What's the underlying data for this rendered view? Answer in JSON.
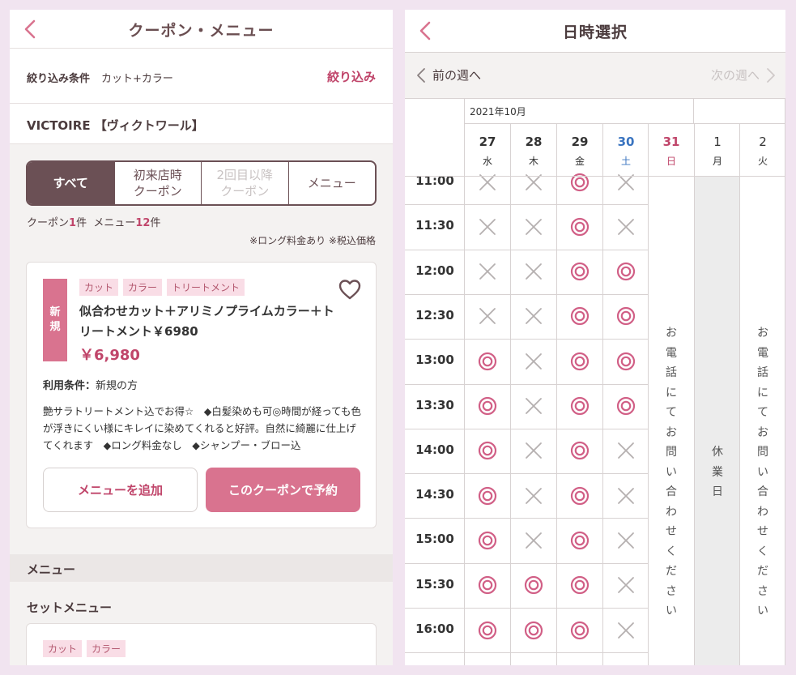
{
  "left": {
    "header": {
      "title": "クーポン・メニュー"
    },
    "filter": {
      "label": "絞り込み条件",
      "value": "カット+カラー",
      "button": "絞り込み"
    },
    "salon": {
      "name": "VICTOIRE 【ヴィクトワール】"
    },
    "tabs": [
      {
        "label": "すべて",
        "state": "active"
      },
      {
        "label": "初来店時\nクーポン",
        "state": "normal"
      },
      {
        "label": "2回目以降\nクーポン",
        "state": "disabled"
      },
      {
        "label": "メニュー",
        "state": "normal"
      }
    ],
    "counts": {
      "coupon_label": "クーポン",
      "coupon_num": "1",
      "coupon_unit": "件",
      "menu_label": "メニュー",
      "menu_num": "12",
      "menu_unit": "件"
    },
    "note": "※ロング料金あり ※税込価格",
    "coupon": {
      "badge": "新\n規",
      "tags": [
        "カット",
        "カラー",
        "トリートメント"
      ],
      "title": "似合わせカット＋アリミノプライムカラー＋トリートメント￥6980",
      "price": "￥6,980",
      "condition_label": "利用条件：",
      "condition_value": "新規の方",
      "description": "艶サラトリートメント込でお得☆　◆白髪染めも可◎時間が経っても色が浮きにくい様にキレイに染めてくれると好評。自然に綺麗に仕上げてくれます　◆ロング料金なし　◆シャンプー・ブロー込",
      "add_button": "メニューを追加",
      "reserve_button": "このクーポンで予約"
    },
    "menu_section": {
      "title": "メニュー"
    },
    "set_menu": {
      "title": "セットメニュー",
      "tags": [
        "カット",
        "カラー"
      ]
    }
  },
  "right": {
    "header": {
      "title": "日時選択"
    },
    "prev_week": "前の週へ",
    "next_week": "次の週へ",
    "month": "2021年10月",
    "days": [
      {
        "num": "27",
        "wd": "水",
        "type": "weekday"
      },
      {
        "num": "28",
        "wd": "木",
        "type": "weekday"
      },
      {
        "num": "29",
        "wd": "金",
        "type": "weekday"
      },
      {
        "num": "30",
        "wd": "土",
        "type": "saturday"
      },
      {
        "num": "31",
        "wd": "日",
        "type": "sunday"
      },
      {
        "num": "1",
        "wd": "月",
        "type": "plain"
      },
      {
        "num": "2",
        "wd": "火",
        "type": "plain"
      }
    ],
    "times": [
      "11:00",
      "11:30",
      "12:00",
      "12:30",
      "13:00",
      "13:30",
      "14:00",
      "14:30",
      "15:00",
      "15:30",
      "16:00"
    ],
    "availability": [
      [
        "x",
        "x",
        "o",
        "x"
      ],
      [
        "x",
        "x",
        "o",
        "x"
      ],
      [
        "x",
        "x",
        "o",
        "o"
      ],
      [
        "x",
        "x",
        "o",
        "o"
      ],
      [
        "o",
        "x",
        "o",
        "o"
      ],
      [
        "o",
        "x",
        "o",
        "o"
      ],
      [
        "o",
        "x",
        "o",
        "x"
      ],
      [
        "o",
        "x",
        "o",
        "x"
      ],
      [
        "o",
        "x",
        "o",
        "x"
      ],
      [
        "o",
        "o",
        "o",
        "x"
      ],
      [
        "o",
        "o",
        "o",
        "x"
      ]
    ],
    "phone_note": "お\n電\n話\nに\nて\nお\n問\nい\n合\nわ\nせ\nく\nだ\nさ\nい",
    "closed": "休\n業\n日",
    "colors": {
      "available": "#d15f86",
      "unavailable": "#b5b0b0",
      "saturday": "#3a74c0",
      "sunday": "#c0456a"
    }
  }
}
